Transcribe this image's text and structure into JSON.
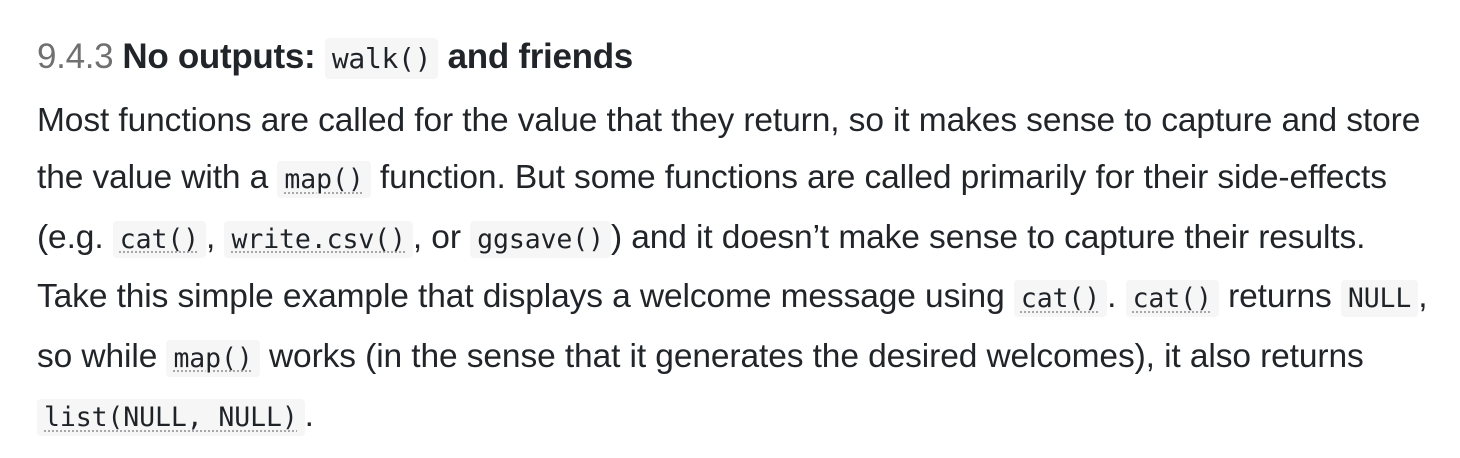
{
  "heading": {
    "number": "9.4.3",
    "text_before": "No outputs:",
    "code": "walk()",
    "text_after": "and friends"
  },
  "paragraph": {
    "t1": "Most functions are called for the value that they return, so it makes sense to capture and store the value with a",
    "c1": "map()",
    "t2": "function. But some functions are called primarily for their side-effects (e.g.",
    "c2": "cat()",
    "t3": ",",
    "c3": "write.csv()",
    "t4": ", or",
    "c4": "ggsave()",
    "t5": ") and it doesn’t make sense to capture their results. Take this simple example that displays a welcome message using",
    "c5": "cat()",
    "t6": ".",
    "c6": "cat()",
    "t7": "returns",
    "c7": "NULL",
    "t8": ", so while",
    "c8": "map()",
    "t9": "works (in the sense that it generates the desired welcomes), it also returns",
    "c9": "list(NULL, NULL)",
    "t10": "."
  }
}
